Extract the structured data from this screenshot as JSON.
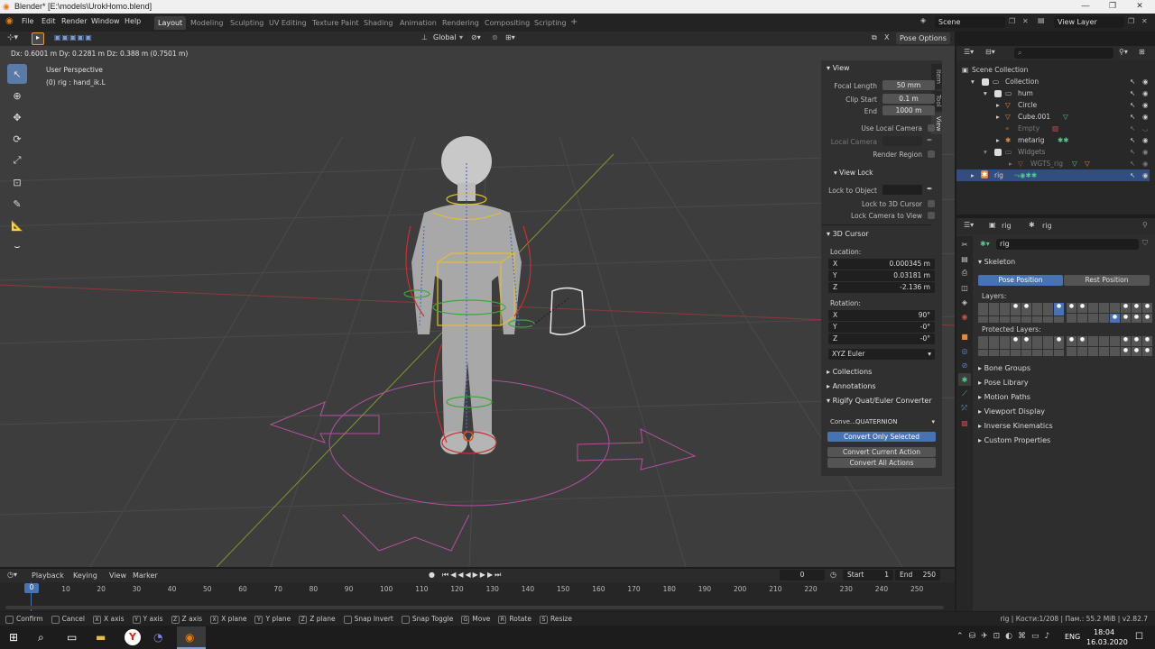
{
  "window": {
    "title": "Blender* [E:\\models\\UrokHomo.blend]"
  },
  "menu": [
    "File",
    "Edit",
    "Render",
    "Window",
    "Help"
  ],
  "workspaces": [
    "Layout",
    "Modeling",
    "Sculpting",
    "UV Editing",
    "Texture Paint",
    "Shading",
    "Animation",
    "Rendering",
    "Compositing",
    "Scripting"
  ],
  "active_workspace": "Layout",
  "scene": {
    "name": "Scene",
    "view_layer": "View Layer"
  },
  "header3d": {
    "orientation": "Global",
    "pose_options": "Pose Options"
  },
  "viewport": {
    "transform_readout": "Dx: 0.6001 m  Dy: 0.2281 m  Dz: 0.388 m (0.7501 m)",
    "perspective": "User Perspective",
    "active_object": "(0) rig : hand_ik.L"
  },
  "npanel": {
    "tabs": [
      "Item",
      "Tool",
      "View"
    ],
    "view_title": "View",
    "focal_length_label": "Focal Length",
    "focal_length": "50 mm",
    "clip_start_label": "Clip Start",
    "clip_start": "0.1 m",
    "clip_end_label": "End",
    "clip_end": "1000 m",
    "use_local_camera": "Use Local Camera",
    "local_camera": "Local Camera",
    "render_region": "Render Region",
    "view_lock_title": "View Lock",
    "lock_to_object": "Lock to Object",
    "lock_to_3d_cursor": "Lock to 3D Cursor",
    "lock_camera_to_view": "Lock Camera to View",
    "cursor_title": "3D Cursor",
    "location_label": "Location:",
    "loc_x": "0.000345 m",
    "loc_y": "0.03181 m",
    "loc_z": "-2.136 m",
    "rotation_label": "Rotation:",
    "rot_x": "90°",
    "rot_y": "-0°",
    "rot_z": "-0°",
    "rotation_mode": "XYZ Euler",
    "collections": "Collections",
    "annotations": "Annotations",
    "rigify_title": "Rigify Quat/Euler Converter",
    "convert_label": "Conve...",
    "convert_value": "QUATERNION",
    "convert_only_selected": "Convert Only Selected",
    "convert_current_action": "Convert Current Action",
    "convert_all_actions": "Convert All Actions",
    "axis_x": "X",
    "axis_y": "Y",
    "axis_z": "Z"
  },
  "outliner": {
    "rows": [
      {
        "label": "Scene Collection"
      },
      {
        "label": "Collection"
      },
      {
        "label": "hum"
      },
      {
        "label": "Circle"
      },
      {
        "label": "Cube.001"
      },
      {
        "label": "Empty"
      },
      {
        "label": "metarig"
      },
      {
        "label": "Widgets"
      },
      {
        "label": "WGTS_rig"
      },
      {
        "label": "rig"
      }
    ]
  },
  "properties": {
    "header_obj": "rig",
    "header_data": "rig",
    "data_name": "rig",
    "skeleton_title": "Skeleton",
    "pose_position": "Pose Position",
    "rest_position": "Rest Position",
    "layers_label": "Layers:",
    "protected_layers_label": "Protected Layers:",
    "sections": [
      "Bone Groups",
      "Pose Library",
      "Motion Paths",
      "Viewport Display",
      "Inverse Kinematics",
      "Custom Properties"
    ]
  },
  "timeline": {
    "menus": [
      "Playback",
      "Keying",
      "View",
      "Marker"
    ],
    "current_frame": "0",
    "start_label": "Start",
    "start": "1",
    "end_label": "End",
    "end": "250",
    "ticks": [
      "0",
      "10",
      "20",
      "30",
      "40",
      "50",
      "60",
      "70",
      "80",
      "90",
      "100",
      "110",
      "120",
      "130",
      "140",
      "150",
      "160",
      "170",
      "180",
      "190",
      "200",
      "210",
      "220",
      "230",
      "240",
      "250"
    ]
  },
  "statusbar": {
    "hints": [
      {
        "key": "",
        "label": "Confirm"
      },
      {
        "key": "",
        "label": "Cancel"
      },
      {
        "key": "X",
        "label": "X axis"
      },
      {
        "key": "Y",
        "label": "Y axis"
      },
      {
        "key": "Z",
        "label": "Z axis"
      },
      {
        "key": "X",
        "label": "X plane"
      },
      {
        "key": "Y",
        "label": "Y plane"
      },
      {
        "key": "Z",
        "label": "Z plane"
      },
      {
        "key": "",
        "label": "Snap Invert"
      },
      {
        "key": "",
        "label": "Snap Toggle"
      },
      {
        "key": "G",
        "label": "Move"
      },
      {
        "key": "R",
        "label": "Rotate"
      },
      {
        "key": "S",
        "label": "Resize"
      }
    ],
    "info": "rig | Кости:1/208 | Пам.: 55.2 MiB | v2.82.7"
  },
  "taskbar": {
    "lang": "ENG",
    "time": "18:04",
    "date": "16.03.2020"
  },
  "colors": {
    "accent": "#4772b3",
    "selected_row": "#334d80",
    "viewport": "#3d3d3d"
  }
}
